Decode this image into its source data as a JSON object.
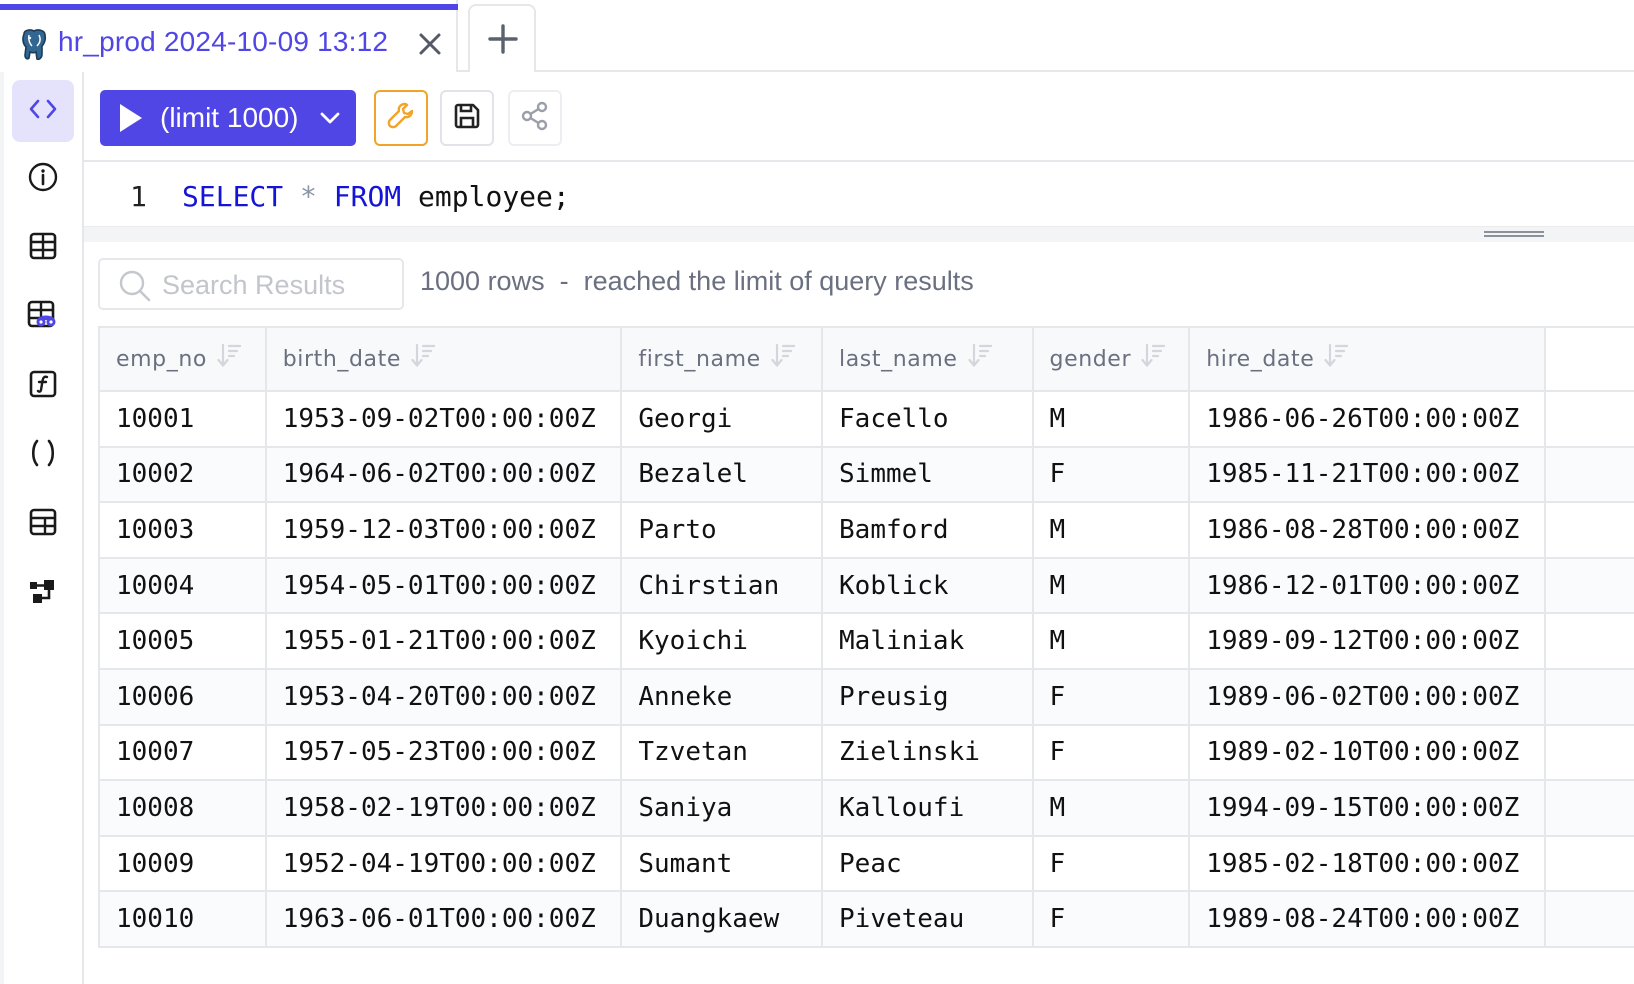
{
  "tabs": [
    {
      "icon": "postgresql-elephant-icon",
      "title": "hr_prod 2024-10-09 13:12",
      "active": true,
      "close_icon": "close-icon"
    }
  ],
  "new_tab_icon": "plus-icon",
  "sidebar": {
    "items": [
      {
        "name": "editor",
        "icon": "code-brackets-icon",
        "active": true
      },
      {
        "name": "info",
        "icon": "info-circle-icon",
        "active": false
      },
      {
        "name": "tables",
        "icon": "table-icon",
        "active": false
      },
      {
        "name": "views",
        "icon": "table-view-icon",
        "active": false
      },
      {
        "name": "functions",
        "icon": "function-icon",
        "active": false
      },
      {
        "name": "procedures",
        "icon": "parentheses-icon",
        "active": false
      },
      {
        "name": "table-grid",
        "icon": "table-grid-icon",
        "active": false
      },
      {
        "name": "schema-diagram",
        "icon": "schema-diagram-icon",
        "active": false
      }
    ]
  },
  "toolbar": {
    "run_label": "(limit 1000)",
    "run_icon": "play-icon",
    "dropdown_icon": "chevron-down-icon",
    "settings_icon": "wrench-icon",
    "save_icon": "floppy-disk-icon",
    "share_icon": "share-icon"
  },
  "editor": {
    "line_number": "1",
    "tokens": {
      "select": "SELECT",
      "star": "*",
      "from": "FROM",
      "table": "employee;"
    }
  },
  "results": {
    "search_placeholder": "Search Results",
    "search_value": "",
    "row_count": "1000 rows",
    "separator": "-",
    "limit_message": "reached the limit of query results"
  },
  "colors": {
    "accent": "#4f46e5",
    "settings_border": "#f0a52a",
    "keyword": "#1414d6"
  },
  "table": {
    "columns": [
      "emp_no",
      "birth_date",
      "first_name",
      "last_name",
      "gender",
      "hire_date"
    ],
    "rows": [
      [
        "10001",
        "1953-09-02T00:00:00Z",
        "Georgi",
        "Facello",
        "M",
        "1986-06-26T00:00:00Z"
      ],
      [
        "10002",
        "1964-06-02T00:00:00Z",
        "Bezalel",
        "Simmel",
        "F",
        "1985-11-21T00:00:00Z"
      ],
      [
        "10003",
        "1959-12-03T00:00:00Z",
        "Parto",
        "Bamford",
        "M",
        "1986-08-28T00:00:00Z"
      ],
      [
        "10004",
        "1954-05-01T00:00:00Z",
        "Chirstian",
        "Koblick",
        "M",
        "1986-12-01T00:00:00Z"
      ],
      [
        "10005",
        "1955-01-21T00:00:00Z",
        "Kyoichi",
        "Maliniak",
        "M",
        "1989-09-12T00:00:00Z"
      ],
      [
        "10006",
        "1953-04-20T00:00:00Z",
        "Anneke",
        "Preusig",
        "F",
        "1989-06-02T00:00:00Z"
      ],
      [
        "10007",
        "1957-05-23T00:00:00Z",
        "Tzvetan",
        "Zielinski",
        "F",
        "1989-02-10T00:00:00Z"
      ],
      [
        "10008",
        "1958-02-19T00:00:00Z",
        "Saniya",
        "Kalloufi",
        "M",
        "1994-09-15T00:00:00Z"
      ],
      [
        "10009",
        "1952-04-19T00:00:00Z",
        "Sumant",
        "Peac",
        "F",
        "1985-02-18T00:00:00Z"
      ],
      [
        "10010",
        "1963-06-01T00:00:00Z",
        "Duangkaew",
        "Piveteau",
        "F",
        "1989-08-24T00:00:00Z"
      ]
    ]
  }
}
